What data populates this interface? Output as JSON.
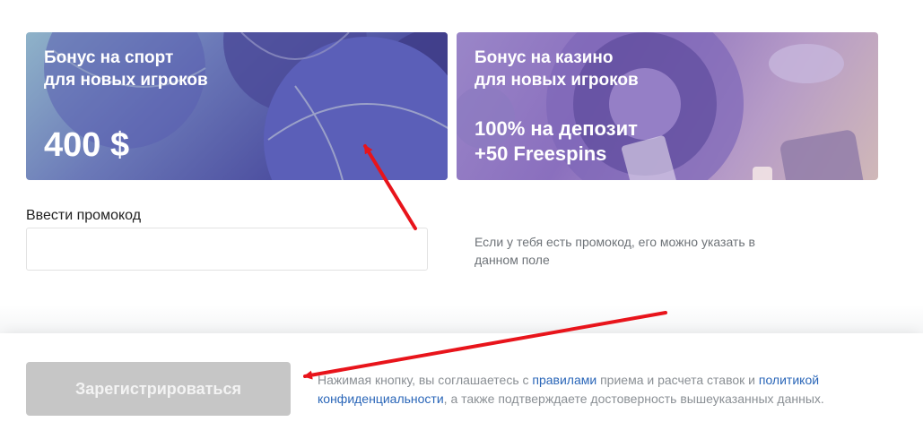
{
  "bonus_cards": {
    "sport": {
      "title_line1": "Бонус на спорт",
      "title_line2": "для новых игроков",
      "amount": "400 $"
    },
    "casino": {
      "title_line1": "Бонус на казино",
      "title_line2": "для новых игроков",
      "offer_line1": "100% на депозит",
      "offer_line2": "+50 Freespins"
    }
  },
  "promo": {
    "label": "Ввести промокод",
    "value": "",
    "placeholder": "",
    "hint": "Если у тебя есть промокод, его можно указать в данном поле"
  },
  "footer": {
    "register_label": "Зарегистрироваться",
    "terms_part1": "Нажимая кнопку, вы соглашаетесь с ",
    "terms_link1": "правилами",
    "terms_part2": " приема и расчета ставок и ",
    "terms_link2": "политикой конфиденциальности",
    "terms_part3": ", а также подтверждаете достоверность вышеуказанных данных."
  },
  "colors": {
    "button_disabled": "#c6c6c6",
    "link": "#2a66b8",
    "annotation_arrow": "#e8141b"
  }
}
